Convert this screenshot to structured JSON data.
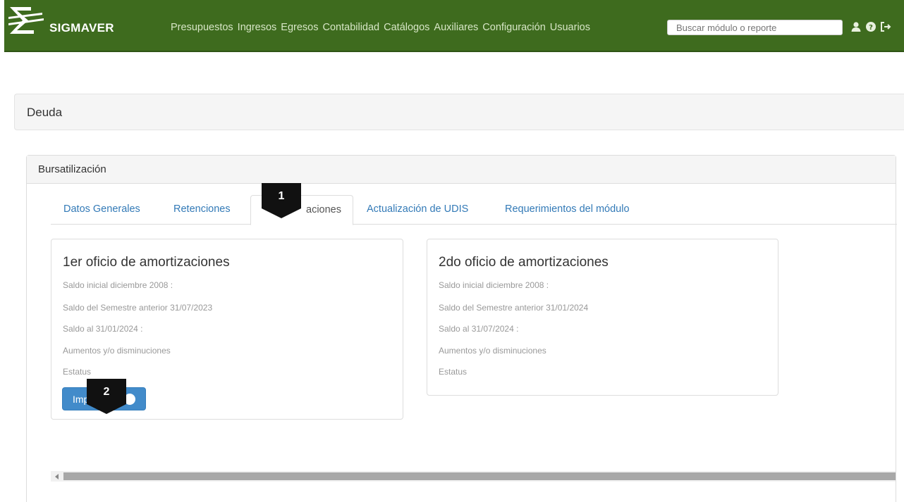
{
  "app": {
    "name": "SIGMAVER"
  },
  "nav": {
    "menu": [
      {
        "label": "Presupuestos"
      },
      {
        "label": "Ingresos"
      },
      {
        "label": "Egresos"
      },
      {
        "label": "Contabilidad"
      },
      {
        "label": "Catálogos"
      },
      {
        "label": "Auxiliares"
      },
      {
        "label": "Configuración"
      },
      {
        "label": "Usuarios"
      }
    ],
    "search_placeholder": "Buscar módulo o reporte",
    "icons": [
      "user-icon",
      "help-icon",
      "logout-icon"
    ]
  },
  "page": {
    "title": "Deuda"
  },
  "panel": {
    "title": "Bursatilización",
    "tabs": [
      {
        "label": "Datos Generales",
        "active": false
      },
      {
        "label": "Retenciones",
        "active": false
      },
      {
        "label": "aciones",
        "active": true
      },
      {
        "label": "Actualización de UDIS",
        "active": false
      },
      {
        "label": "Requerimientos del módulo",
        "active": false
      }
    ]
  },
  "cards": [
    {
      "title": "1er oficio de amortizaciones",
      "rows": [
        "Saldo inicial diciembre 2008 :",
        "Saldo del Semestre anterior 31/07/2023",
        "Saldo al 31/01/2024 :",
        "Aumentos y/o disminuciones",
        "Estatus"
      ],
      "button_label": "Imp"
    },
    {
      "title": "2do oficio de amortizaciones",
      "rows": [
        "Saldo inicial diciembre 2008 :",
        "Saldo del Semestre anterior 31/01/2024",
        "Saldo al 31/07/2024 :",
        "Aumentos y/o disminuciones",
        "Estatus"
      ]
    }
  ],
  "markers": [
    "1",
    "2"
  ],
  "colors": {
    "navbar": "#3e6b1e",
    "link": "#337ab7",
    "primary_button": "#428bca",
    "marker": "#111111"
  }
}
